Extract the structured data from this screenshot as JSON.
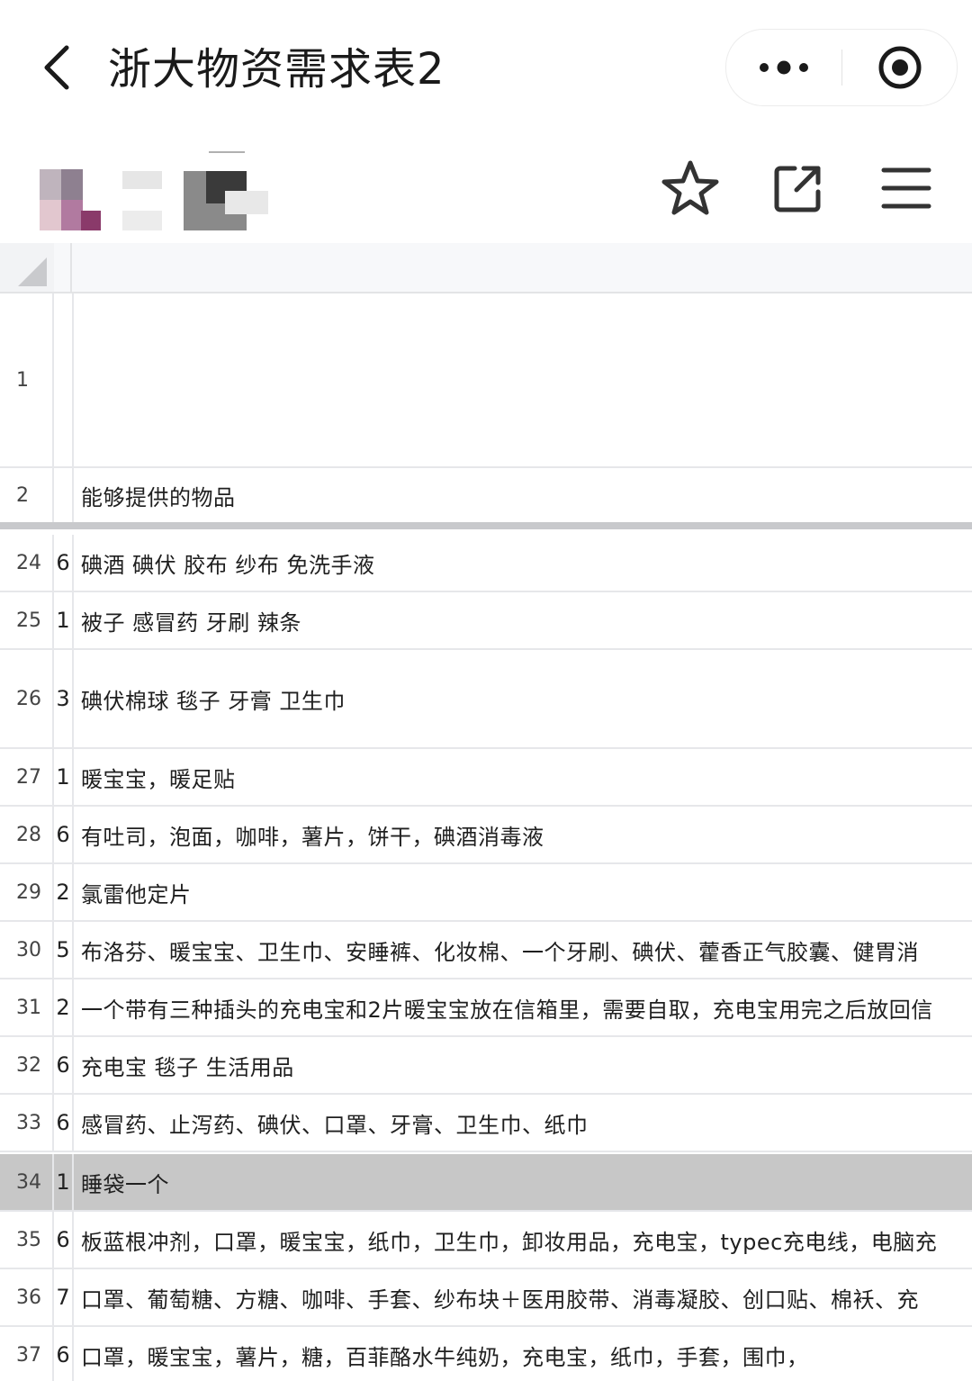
{
  "nav": {
    "title": "浙大物资需求表2",
    "back_icon": "chevron-left-icon",
    "more_icon": "more-dots-icon",
    "close_icon": "target-circle-icon"
  },
  "toolbar": {
    "star_icon": "star-icon",
    "share_icon": "share-external-icon",
    "menu_icon": "hamburger-menu-icon"
  },
  "sheet": {
    "header_rows": [
      {
        "num": "1",
        "a": "",
        "b": ""
      },
      {
        "num": "2",
        "a": "",
        "b": "能够提供的物品"
      }
    ],
    "rows": [
      {
        "num": "24",
        "a": "6",
        "b": "碘酒 碘伏 胶布 纱布 免洗手液"
      },
      {
        "num": "25",
        "a": "1",
        "b": "被子 感冒药 牙刷  辣条"
      },
      {
        "num": "26",
        "a": "3",
        "b": "碘伏棉球 毯子 牙膏 卫生巾"
      },
      {
        "num": "27",
        "a": "1",
        "b": "暖宝宝，暖足贴"
      },
      {
        "num": "28",
        "a": "6",
        "b": "有吐司，泡面，咖啡，薯片，饼干，碘酒消毒液"
      },
      {
        "num": "29",
        "a": "2",
        "b": "氯雷他定片"
      },
      {
        "num": "30",
        "a": "5",
        "b": "布洛芬、暖宝宝、卫生巾、安睡裤、化妆棉、一个牙刷、碘伏、藿香正气胶囊、健胃消"
      },
      {
        "num": "31",
        "a": "2",
        "b": "一个带有三种插头的充电宝和2片暖宝宝放在信箱里，需要自取，充电宝用完之后放回信"
      },
      {
        "num": "32",
        "a": "6",
        "b": "充电宝 毯子 生活用品"
      },
      {
        "num": "33",
        "a": "6",
        "b": "感冒药、止泻药、碘伏、口罩、牙膏、卫生巾、纸巾"
      },
      {
        "num": "34",
        "a": "1",
        "b": "睡袋一个"
      },
      {
        "num": "35",
        "a": "6",
        "b": "板蓝根冲剂，口罩，暖宝宝，纸巾，卫生巾，卸妆用品，充电宝，typec充电线，电脑充"
      },
      {
        "num": "36",
        "a": "7",
        "b": "口罩、葡萄糖、方糖、咖啡、手套、纱布块＋医用胶带、消毒凝胶、创口贴、棉袄、充"
      },
      {
        "num": "37",
        "a": "6",
        "b": "口罩，暖宝宝，薯片，糖，百菲酪水牛纯奶，充电宝，纸巾，手套，围巾，"
      }
    ]
  }
}
